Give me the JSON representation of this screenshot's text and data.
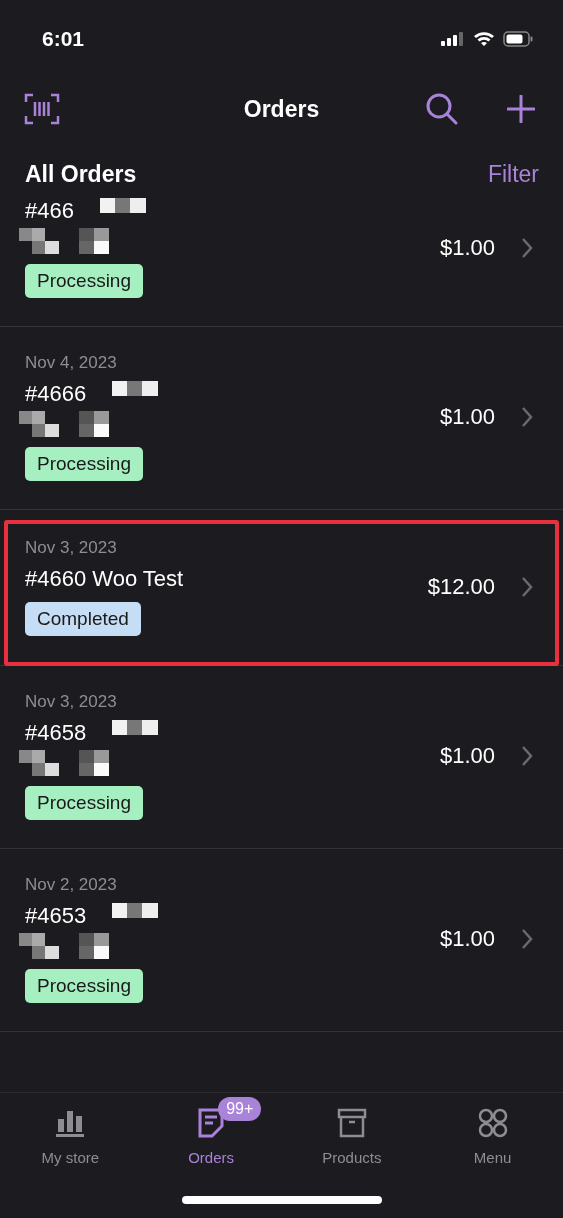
{
  "status_bar": {
    "time": "6:01"
  },
  "nav": {
    "title": "Orders"
  },
  "list_header": {
    "title": "All Orders",
    "filter": "Filter"
  },
  "orders": [
    {
      "number": "#466",
      "name_redacted": true,
      "total": "$1.00",
      "status": "Processing",
      "kind": "processing",
      "highlighted": false
    },
    {
      "date": "Nov 4, 2023",
      "number": "#4666",
      "name_redacted": true,
      "total": "$1.00",
      "status": "Processing",
      "kind": "processing",
      "highlighted": false
    },
    {
      "date": "Nov 3, 2023",
      "number": "#4660 Woo Test",
      "name_redacted": false,
      "total": "$12.00",
      "status": "Completed",
      "kind": "completed",
      "highlighted": true
    },
    {
      "date": "Nov 3, 2023",
      "number": "#4658",
      "name_redacted": true,
      "total": "$1.00",
      "status": "Processing",
      "kind": "processing",
      "highlighted": false
    },
    {
      "date": "Nov 2, 2023",
      "number": "#4653",
      "name_redacted": true,
      "total": "$1.00",
      "status": "Processing",
      "kind": "processing",
      "highlighted": false
    }
  ],
  "tabs": [
    {
      "label": "My store",
      "selected": false
    },
    {
      "label": "Orders",
      "selected": true,
      "badge": "99+"
    },
    {
      "label": "Products",
      "selected": false
    },
    {
      "label": "Menu",
      "selected": false
    }
  ]
}
